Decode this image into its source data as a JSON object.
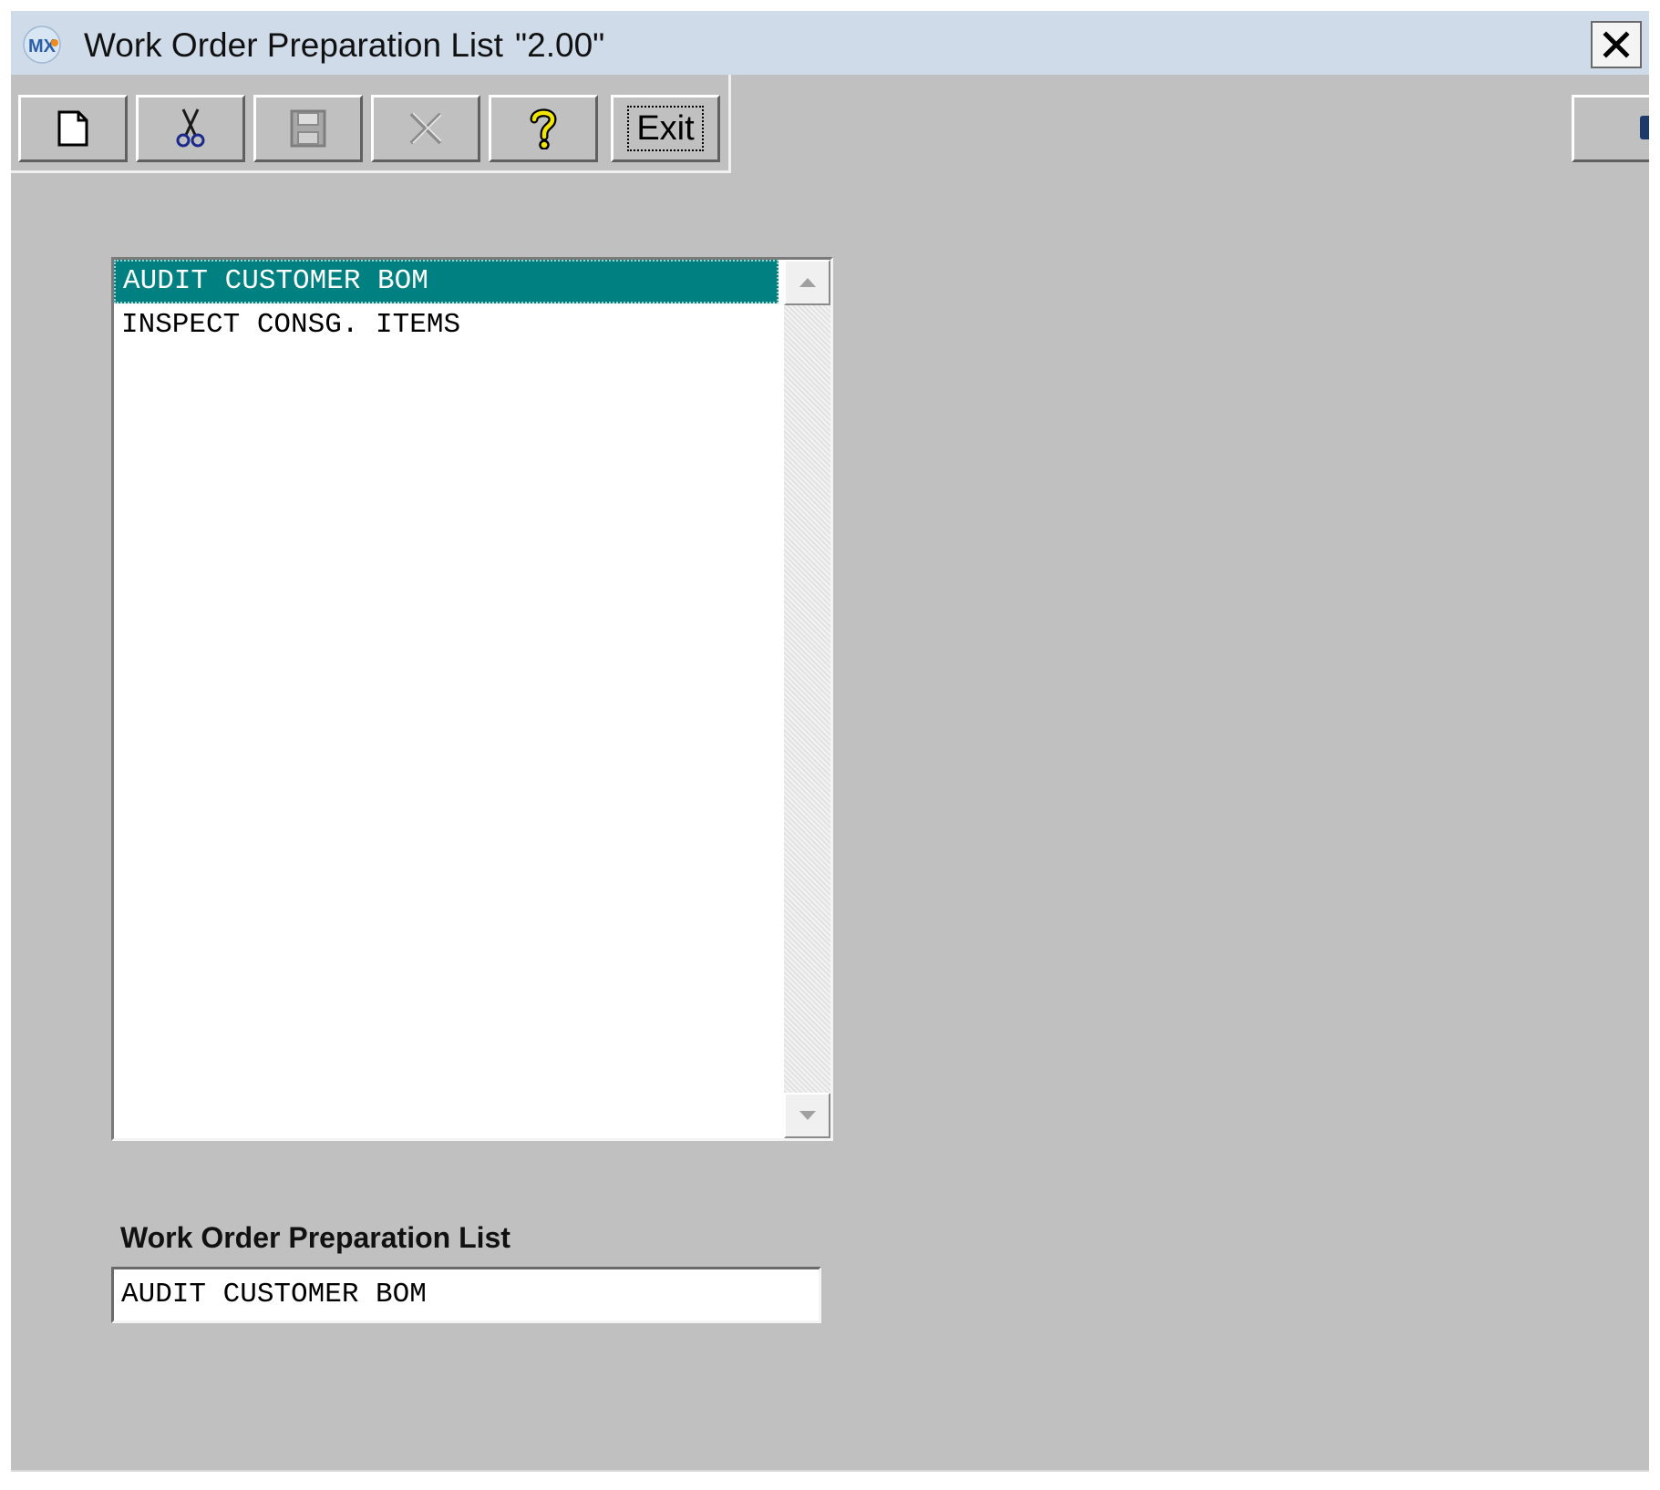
{
  "window": {
    "app_logo": "MX",
    "title": "Work Order Preparation List",
    "version": "\"2.00\"",
    "close_icon": "close-icon"
  },
  "toolbar": {
    "buttons": [
      {
        "id": "new",
        "icon": "new-document-icon",
        "enabled": true
      },
      {
        "id": "cut",
        "icon": "scissors-icon",
        "enabled": true
      },
      {
        "id": "save",
        "icon": "save-disk-icon",
        "enabled": false
      },
      {
        "id": "delete",
        "icon": "delete-x-icon",
        "enabled": false
      },
      {
        "id": "help",
        "icon": "help-question-icon",
        "enabled": true
      }
    ],
    "exit_label": "Exit"
  },
  "list": {
    "items": [
      "AUDIT CUSTOMER BOM",
      "INSPECT CONSG. ITEMS"
    ],
    "selected_index": 0
  },
  "form": {
    "label": "Work Order Preparation List",
    "value": "AUDIT CUSTOMER BOM"
  },
  "colors": {
    "selection": "#008080",
    "window_bg": "#c0c0c0",
    "titlebar": "#cfdbe9",
    "help_icon": "#f2e600",
    "cut_icon": "#1a2a8a"
  }
}
